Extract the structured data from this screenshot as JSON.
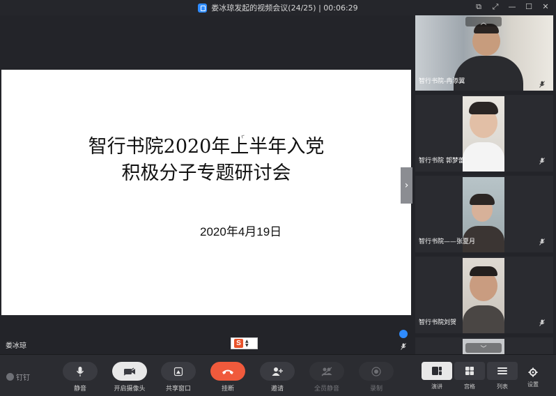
{
  "titlebar": {
    "title": "娄冰琼发起的视频会议(24/25) | 00:06:29",
    "icon": "shield-lock-icon",
    "controls": [
      "share-window-icon",
      "fullscreen-icon",
      "minimize-icon",
      "maximize-icon",
      "close-icon"
    ]
  },
  "slide": {
    "title_line1": "智行书院2020年上半年入党",
    "title_line2": "积极分子专题研讨会",
    "date": "2020年4月19日"
  },
  "stage": {
    "speaker_name": "娄冰琼",
    "ime_letter": "S"
  },
  "participants": [
    {
      "name": "智行书院-冉添翼"
    },
    {
      "name": "智行书院  郭梦蕾"
    },
    {
      "name": "智行书院——张夏月"
    },
    {
      "name": "智行书院刘贺"
    }
  ],
  "toolbar": {
    "brand": "钉钉",
    "mute": "静音",
    "camera": "开启摄像头",
    "share": "共享窗口",
    "hangup": "挂断",
    "invite": "邀请",
    "mute_all": "全员静音",
    "record": "录制",
    "view_lecture": "演讲",
    "view_grid": "宫格",
    "view_list": "列表",
    "settings": "设置"
  },
  "colors": {
    "accent": "#2f8cff",
    "hangup": "#f05a3c",
    "background": "#232429"
  }
}
